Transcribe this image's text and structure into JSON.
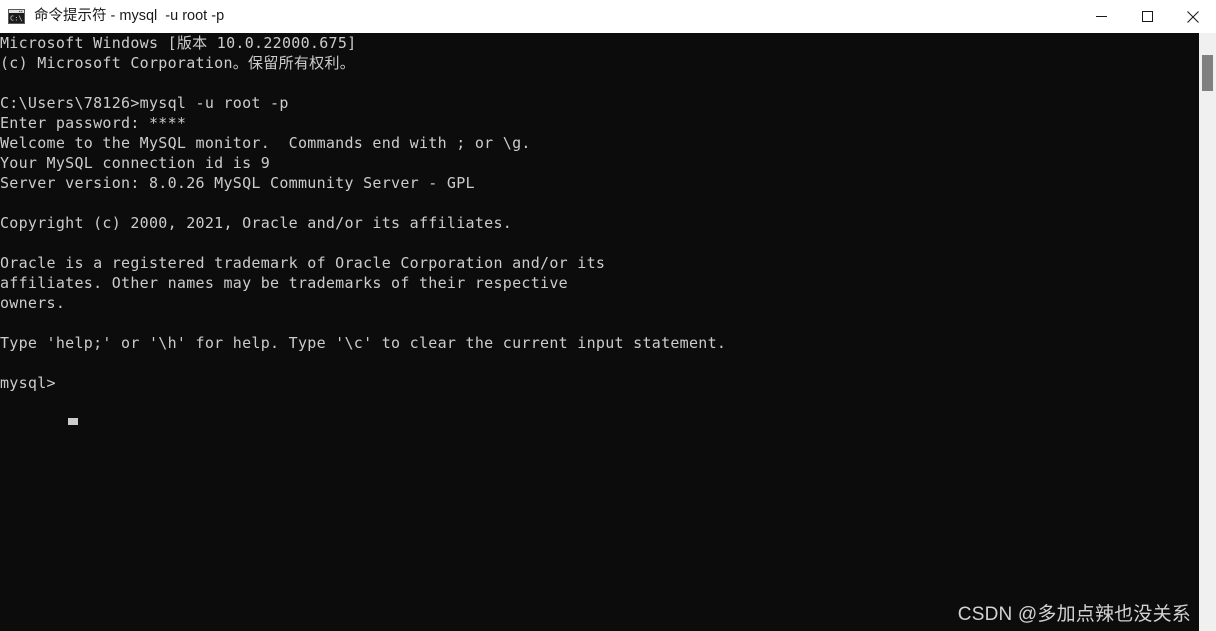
{
  "window": {
    "title": "命令提示符 - mysql  -u root -p",
    "icon": "cmd-console-icon",
    "titlebar_bg": "#ffffff",
    "title_color": "#1a1a1a",
    "console_bg": "#0c0c0c",
    "console_fg": "#cccccc"
  },
  "controls": {
    "minimize_label": "Minimize",
    "maximize_label": "Maximize",
    "close_label": "Close"
  },
  "console": {
    "lines": [
      "Microsoft Windows [版本 10.0.22000.675]",
      "(c) Microsoft Corporation。保留所有权利。",
      "",
      "C:\\Users\\78126>mysql -u root -p",
      "Enter password: ****",
      "Welcome to the MySQL monitor.  Commands end with ; or \\g.",
      "Your MySQL connection id is 9",
      "Server version: 8.0.26 MySQL Community Server - GPL",
      "",
      "Copyright (c) 2000, 2021, Oracle and/or its affiliates.",
      "",
      "Oracle is a registered trademark of Oracle Corporation and/or its",
      "affiliates. Other names may be trademarks of their respective",
      "owners.",
      "",
      "Type 'help;' or '\\h' for help. Type '\\c' to clear the current input statement.",
      "",
      "mysql>"
    ],
    "text": "Microsoft Windows [版本 10.0.22000.675]\n(c) Microsoft Corporation。保留所有权利。\n\nC:\\Users\\78126>mysql -u root -p\nEnter password: ****\nWelcome to the MySQL monitor.  Commands end with ; or \\g.\nYour MySQL connection id is 9\nServer version: 8.0.26 MySQL Community Server - GPL\n\nCopyright (c) 2000, 2021, Oracle and/or its affiliates.\n\nOracle is a registered trademark of Oracle Corporation and/or its\naffiliates. Other names may be trademarks of their respective\nowners.\n\nType 'help;' or '\\h' for help. Type '\\c' to clear the current input statement.\n\nmysql>",
    "prompt": "mysql>",
    "command": "mysql -u root -p",
    "password_mask": "****",
    "server_version": "8.0.26",
    "connection_id": "9",
    "os_version": "10.0.22000.675"
  },
  "watermark": {
    "text": "CSDN @多加点辣也没关系"
  },
  "scrollbar": {
    "orientation": "vertical",
    "track_color": "#f0f0f0",
    "thumb_color": "#808080"
  }
}
